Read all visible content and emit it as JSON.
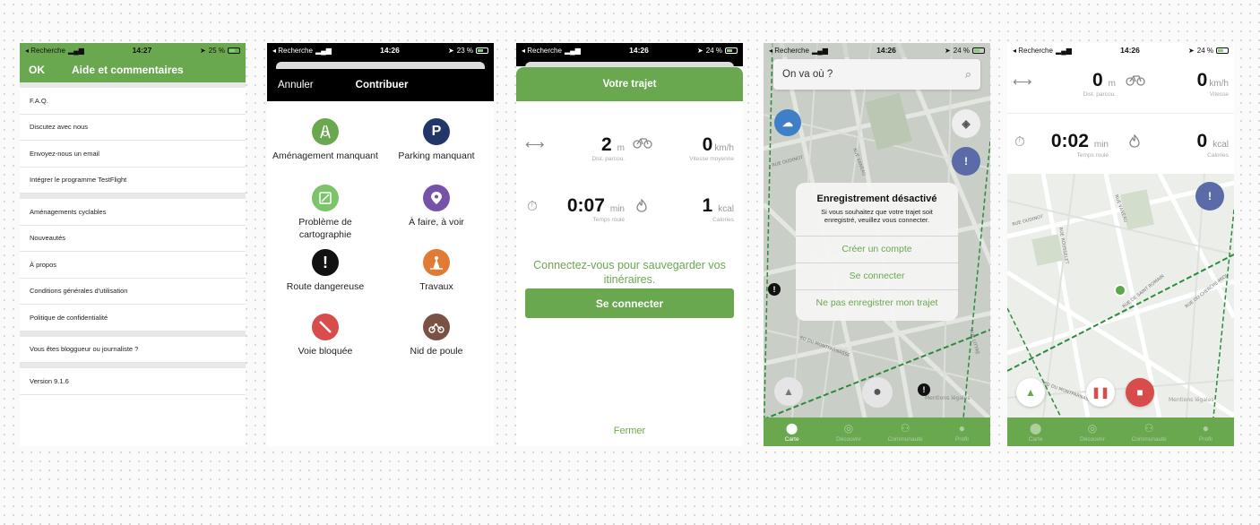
{
  "status_bars": {
    "s1": {
      "back": "◂ Recherche",
      "time": "14:27",
      "battery": "25 %"
    },
    "s2": {
      "back": "◂ Recherche",
      "time": "14:26",
      "battery": "23 %"
    },
    "s3": {
      "back": "◂ Recherche",
      "time": "14:26",
      "battery": "24 %"
    },
    "s4": {
      "back": "◂ Recherche",
      "time": "14:26",
      "battery": "24 %"
    },
    "s5": {
      "back": "◂ Recherche",
      "time": "14:26",
      "battery": "24 %"
    }
  },
  "colors": {
    "brand_green": "#6aa84f",
    "danger_red": "#d94c4c",
    "purple": "#7652a8",
    "navy": "#22366b",
    "orange": "#e07a35",
    "slate": "#5b6ba8"
  },
  "help": {
    "ok": "OK",
    "title": "Aide et commentaires",
    "group1": [
      "F.A.Q.",
      "Discutez avec nous",
      "Envoyez-nous un email",
      "Intégrer le programme TestFlight"
    ],
    "group2": [
      "Aménagements cyclables",
      "Nouveautés",
      "À propos",
      "Conditions générales d'utilisation",
      "Politique de confidentialité"
    ],
    "group3": [
      "Vous êtes bloggueur ou journaliste ?"
    ],
    "group4": [
      "Version 9.1.6"
    ]
  },
  "contribute": {
    "cancel": "Annuler",
    "title": "Contribuer",
    "items": [
      {
        "label": "Aménagement manquant",
        "icon": "bike-lane-icon"
      },
      {
        "label": "Parking manquant",
        "icon": "bike-parking-icon"
      },
      {
        "label": "Problème de cartographie",
        "icon": "map-edit-icon"
      },
      {
        "label": "À faire, à voir",
        "icon": "point-of-interest-icon"
      },
      {
        "label": "Route dangereuse",
        "icon": "danger-icon"
      },
      {
        "label": "Travaux",
        "icon": "roadworks-icon"
      },
      {
        "label": "Voie bloquée",
        "icon": "blocked-icon"
      },
      {
        "label": "Nid de poule",
        "icon": "pothole-icon"
      }
    ]
  },
  "trip": {
    "title": "Votre trajet",
    "distance": {
      "value": "2",
      "unit": "m",
      "label": "Dist. parcou."
    },
    "speed": {
      "value": "0",
      "unit": "km/h",
      "label": "Vitesse moyenne"
    },
    "time": {
      "value": "0:07",
      "unit": "min",
      "label": "Temps roulé"
    },
    "calories": {
      "value": "1",
      "unit": "kcal",
      "label": "Calories"
    },
    "message": "Connectez-vous pour sauvegarder vos itinéraires.",
    "login": "Se connecter",
    "close": "Fermer"
  },
  "map_dialog": {
    "search_placeholder": "On va où ?",
    "title": "Enregistrement désactivé",
    "message": "Si vous souhaitez que votre trajet soit enregistré, veuillez vous connecter.",
    "buttons": [
      "Créer un compte",
      "Se connecter",
      "Ne pas enregistrer mon trajet"
    ],
    "streets": [
      "RUE OUDINOT",
      "RUE VANEAU",
      "RUE ROUSSELET",
      "RUE DE SAINT ROMAIN",
      "RUE DU CHERCHE-MIDI",
      "BD DU MONTPARNASSE",
      "RUE LITTRÉ"
    ],
    "legal": "Mentions légales",
    "tabs": [
      "Carte",
      "Découvrir",
      "Communauté",
      "Profil"
    ]
  },
  "ride": {
    "distance": {
      "value": "0",
      "unit": "m",
      "label": "Dist. parcou."
    },
    "speed": {
      "value": "0",
      "unit": "km/h",
      "label": "Vitesse"
    },
    "time": {
      "value": "0:02",
      "unit": "min",
      "label": "Temps roulé"
    },
    "calories": {
      "value": "0",
      "unit": "kcal",
      "label": "Calories"
    },
    "streets": [
      "RUE OUDINOT",
      "RUE VANEAU",
      "RUE ROUSSELET",
      "RUE DE SAINT ROMAIN",
      "RUE DU CHERCHE-MIDI",
      "BD DU MONTPARNASSE"
    ],
    "legal": "Mentions légales",
    "tabs": [
      "Carte",
      "Découvrir",
      "Communauté",
      "Profil"
    ]
  }
}
